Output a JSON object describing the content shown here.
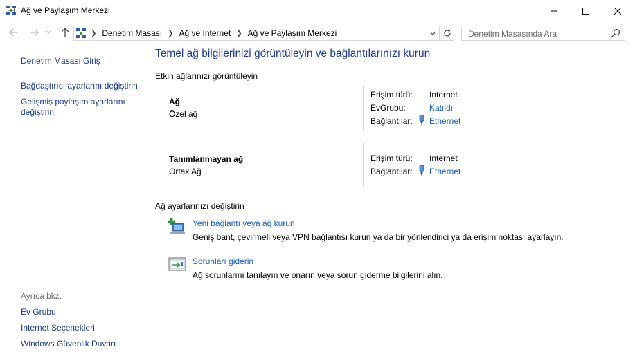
{
  "window": {
    "title": "Ağ ve Paylaşım Merkezi",
    "icon": "network-sharing-center-icon"
  },
  "address": {
    "breadcrumbs": [
      "Denetim Masası",
      "Ağ ve Internet",
      "Ağ ve Paylaşım Merkezi"
    ],
    "search_placeholder": "Denetim Masasında Ara"
  },
  "left_pane": {
    "links": [
      "Denetim Masası Giriş",
      "Bağdaştırıcı ayarlarını değiştirin",
      "Gelişmiş paylaşım ayarlarını değiştirin"
    ],
    "see_also_label": "Ayrıca bkz.",
    "see_also": [
      "Ev Grubu",
      "Internet Seçenekleri",
      "Windows Güvenlik Duvarı"
    ]
  },
  "main": {
    "title": "Temel ağ bilgilerinizi görüntüleyin ve bağlantılarınızı kurun",
    "active_networks_heading": "Etkin ağlarınızı görüntüleyin",
    "networks": [
      {
        "name": "Ağ",
        "category": "Özel ağ",
        "access_label": "Erişim türü:",
        "access_value": "Internet",
        "homegroup_label": "EvGrubu:",
        "homegroup_value": "Katıldı",
        "connections_label": "Bağlantılar:",
        "connections_value": "Ethernet"
      },
      {
        "name": "Tanımlanmayan ağ",
        "category": "Ortak Ağ",
        "access_label": "Erişim türü:",
        "access_value": "Internet",
        "connections_label": "Bağlantılar:",
        "connections_value": "Ethernet"
      }
    ],
    "change_settings_heading": "Ağ ayarlarınızı değiştirin",
    "tasks": [
      {
        "icon": "new-connection-icon",
        "title": "Yeni bağlantı veya ağ kurun",
        "description": "Geniş bant, çevirmeli veya VPN bağlantısı kurun ya da bir yönlendirici ya da erişim noktası ayarlayın."
      },
      {
        "icon": "troubleshoot-icon",
        "title": "Sorunları giderin",
        "description": "Ağ sorunlarını tanılayın ve onarın veya sorun giderme bilgilerini alın."
      }
    ]
  }
}
